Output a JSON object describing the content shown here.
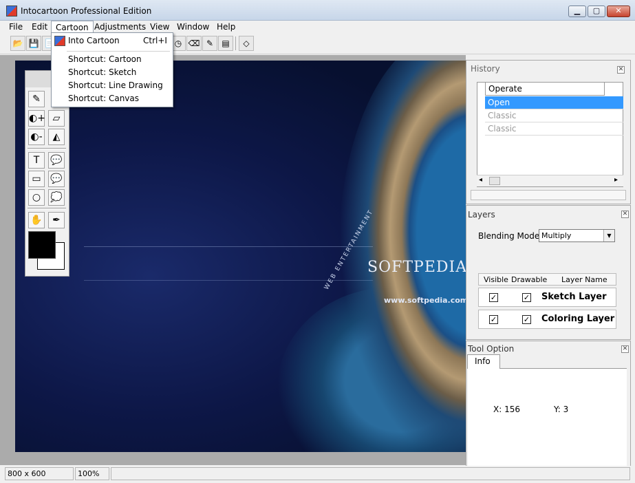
{
  "window": {
    "title": "Intocartoon Professional Edition",
    "min_glyph": "▁",
    "max_glyph": "▢",
    "close_glyph": "✕"
  },
  "menubar": {
    "items": [
      "File",
      "Edit",
      "Cartoon",
      "Adjustments",
      "View",
      "Window",
      "Help"
    ]
  },
  "toolbar": {
    "icons": [
      "open-folder-icon",
      "save-icon",
      "copy-icon",
      "timer-icon",
      "eraser-icon",
      "brush-tools-icon",
      "layers-tools-icon",
      "book-icon"
    ],
    "glyphs": [
      "📂",
      "💾",
      "📄",
      "◷",
      "⌫",
      "✎",
      "▤",
      "◇"
    ]
  },
  "cartoon_menu": {
    "items": [
      {
        "label": "Into Cartoon",
        "shortcut": "Ctrl+I"
      },
      {
        "label": "Shortcut: Cartoon",
        "shortcut": ""
      },
      {
        "label": "Shortcut: Sketch",
        "shortcut": ""
      },
      {
        "label": "Shortcut: Line Drawing",
        "shortcut": ""
      },
      {
        "label": "Shortcut: Canvas",
        "shortcut": ""
      }
    ]
  },
  "canvas": {
    "watermark_main": "SOFTPEDIA",
    "watermark_url": "www.softpedia.com",
    "watermark_sub": "WEB ENTERTAINMENT"
  },
  "tools": {
    "glyphs": [
      "✎",
      "",
      "◐+",
      "▱",
      "◐-",
      "◭",
      "T",
      "💬",
      "▭",
      "💬",
      "○",
      "💭",
      "✋",
      "✒"
    ]
  },
  "history": {
    "title": "History",
    "column": "Operate",
    "rows": [
      "Open",
      "Classic",
      "Classic"
    ],
    "left_arrow": "◂",
    "right_arrow": "▸",
    "close_glyph": "✕"
  },
  "layers": {
    "title": "Layers",
    "blending_label": "Blending Mode:",
    "blending_value": "Multiply",
    "columns": [
      "Visible",
      "Drawable",
      "Layer Name"
    ],
    "rows": [
      {
        "name": "Sketch Layer",
        "visible": "✓",
        "drawable": "✓"
      },
      {
        "name": "Coloring Layer",
        "visible": "✓",
        "drawable": "✓"
      }
    ],
    "close_glyph": "✕",
    "arrow_glyph": "▼"
  },
  "tool_option": {
    "title": "Tool Option",
    "tab": "Info",
    "x_label": "X: 156",
    "y_label": "Y: 3",
    "close_glyph": "✕"
  },
  "statusbar": {
    "size": "800 x 600",
    "zoom": "100%"
  }
}
